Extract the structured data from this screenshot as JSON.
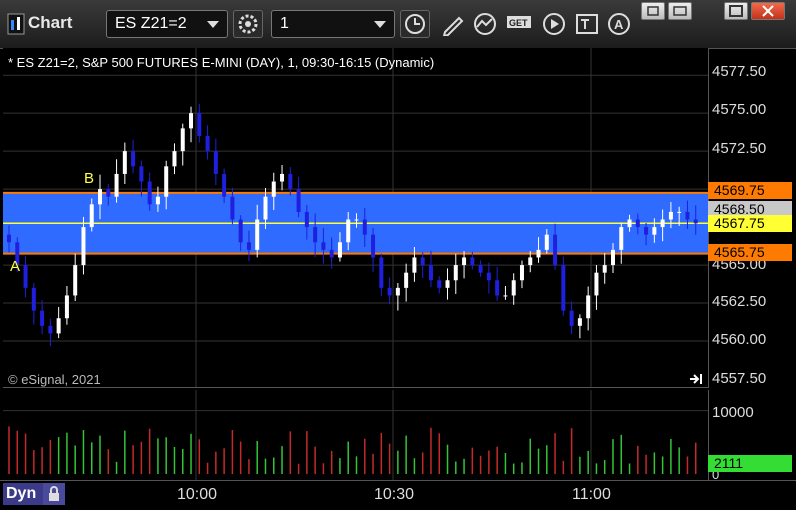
{
  "toolbar": {
    "title": "Chart",
    "symbol_value": "ES Z21=2",
    "interval_value": "1",
    "icons": [
      "gear-icon",
      "clock-icon",
      "pencil-icon",
      "study-icon",
      "get-icon",
      "play-icon",
      "text-tool-icon",
      "alert-icon"
    ]
  },
  "window_controls": [
    "restore-icon",
    "move-icon",
    "maximize-icon",
    "close-icon"
  ],
  "chart": {
    "description": "* ES Z21=2, S&P 500 FUTURES E-MINI (DAY), 1, 09:30-16:15 (Dynamic)",
    "copyright": "© eSignal, 2021",
    "price_labels": [
      "4577.50",
      "4575.00",
      "4572.50",
      "4565.00",
      "4562.50",
      "4560.00",
      "4557.50"
    ],
    "tags": {
      "upper": "4569.75",
      "mid": "4568.50",
      "last": "4567.75",
      "lower": "4565.75",
      "volume": "2111"
    },
    "annotations": {
      "a": "A",
      "b": "B"
    },
    "volume_labels": [
      "10000",
      "0"
    ],
    "time_labels": [
      "10:00",
      "10:30",
      "11:00"
    ],
    "dyn_label": "Dyn",
    "colors": {
      "band": "#2f6bff",
      "up": "#ffffff",
      "down": "#1f1fe0",
      "orange": "#ff7a00",
      "yellow": "#ffff33",
      "vol_up": "#35c435",
      "vol_down": "#c42a2a"
    }
  },
  "chart_data": {
    "type": "candlestick",
    "title": "* ES Z21=2, S&P 500 FUTURES E-MINI (DAY), 1, 09:30-16:15 (Dynamic)",
    "ylim": [
      4557.5,
      4578.5
    ],
    "x_ticks": [
      "10:00",
      "10:30",
      "11:00"
    ],
    "closes": [
      4566.5,
      4565.0,
      4563.5,
      4562.0,
      4561.0,
      4560.5,
      4561.5,
      4563.0,
      4565.0,
      4567.5,
      4569.0,
      4570.0,
      4569.5,
      4571.0,
      4572.5,
      4571.5,
      4570.5,
      4569.0,
      4569.5,
      4571.5,
      4572.5,
      4574.0,
      4575.0,
      4573.5,
      4572.5,
      4571.0,
      4569.5,
      4568.0,
      4566.5,
      4566.0,
      4568.0,
      4569.5,
      4570.5,
      4571.0,
      4570.0,
      4568.5,
      4567.5,
      4566.5,
      4566.0,
      4565.5,
      4566.5,
      4568.0,
      4568.0,
      4567.0,
      4565.5,
      4563.5,
      4563.0,
      4563.5,
      4564.5,
      4565.5,
      4565.0,
      4564.0,
      4563.5,
      4564.0,
      4565.0,
      4565.5,
      4565.0,
      4564.5,
      4564.0,
      4563.0,
      4563.0,
      4564.0,
      4565.0,
      4565.5,
      4566.0,
      4567.0,
      4565.0,
      4562.0,
      4561.0,
      4561.5,
      4563.0,
      4564.5,
      4565.0,
      4566.0,
      4567.5,
      4568.0,
      4567.5,
      4567.0,
      4567.5,
      4568.0,
      4568.5,
      4568.5,
      4568.0,
      4567.75
    ],
    "volume_ylim": [
      0,
      12000
    ],
    "last_volume": 2111
  }
}
